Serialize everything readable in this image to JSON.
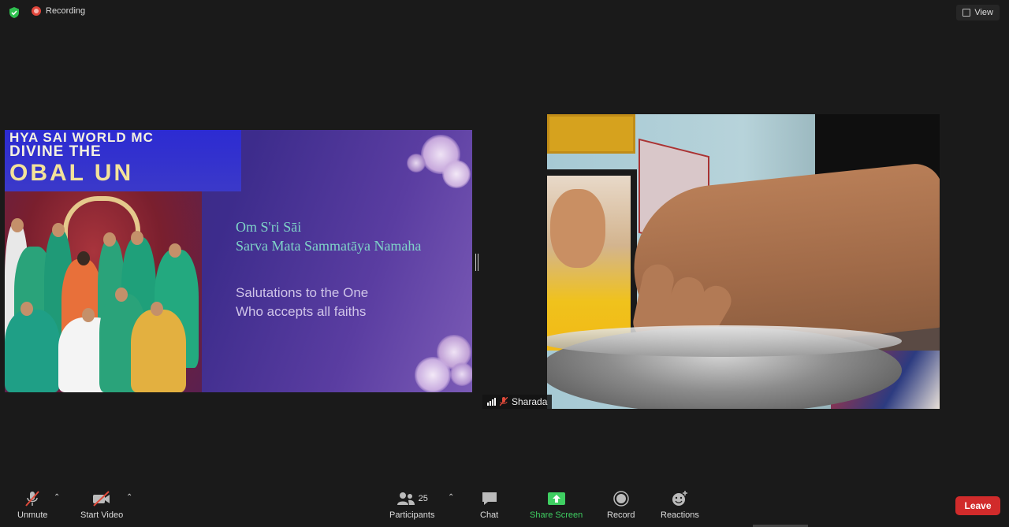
{
  "topbar": {
    "recording_label": "Recording",
    "view_label": "View",
    "shield_icon": "shield-check-icon",
    "colors": {
      "shield": "#2fbf4f",
      "record_dot": "#e0453a"
    }
  },
  "slide": {
    "banner_lines": [
      "HYA  SAI  WORLD  MC",
      "DIVINE   THE",
      "OBAL   UN"
    ],
    "title_line1": "Om S'ri Sāi",
    "title_line2": "Sarva Mata Sammatāya Namaha",
    "subtitle_line1": "Salutations to the One",
    "subtitle_line2": "Who accepts all faiths",
    "colors": {
      "title": "#7fd3c8",
      "subtitle": "#cfc4e8",
      "background": "#3d2c8c"
    }
  },
  "participant": {
    "name": "Sharada",
    "muted": true
  },
  "toolbar": {
    "unmute_label": "Unmute",
    "start_video_label": "Start Video",
    "participants_label": "Participants",
    "participants_count": "25",
    "chat_label": "Chat",
    "share_screen_label": "Share Screen",
    "record_label": "Record",
    "reactions_label": "Reactions",
    "leave_label": "Leave",
    "colors": {
      "share": "#3fcf62",
      "leave": "#d12b2b"
    }
  }
}
